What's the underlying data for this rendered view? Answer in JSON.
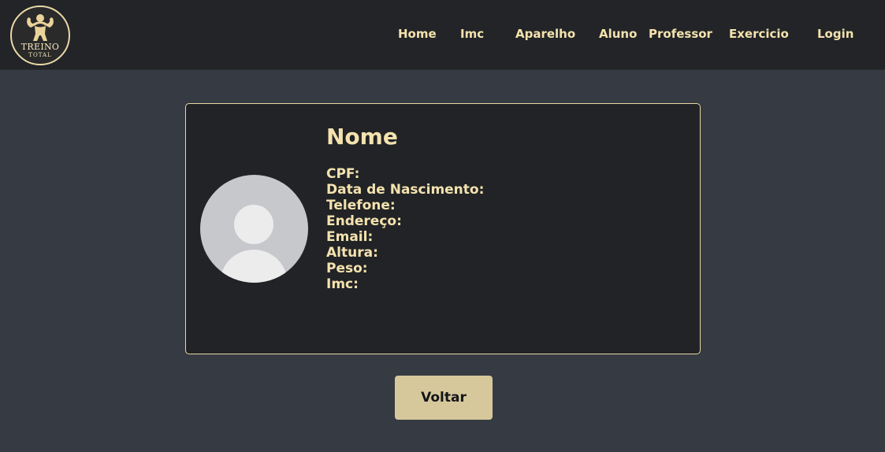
{
  "logo": {
    "line1": "TREINO",
    "line2": "TOTAL",
    "icon": "bodybuilder-icon"
  },
  "nav": {
    "items": [
      {
        "label": "Home"
      },
      {
        "label": "Imc"
      },
      {
        "label": "Aparelho"
      },
      {
        "label": "Aluno"
      },
      {
        "label": "Professor"
      },
      {
        "label": "Exercicio"
      },
      {
        "label": "Login"
      }
    ]
  },
  "profile": {
    "name": "Nome",
    "avatar_icon": "user-placeholder-icon",
    "fields": [
      {
        "label": "CPF:"
      },
      {
        "label": "Data de Nascimento:"
      },
      {
        "label": "Telefone:"
      },
      {
        "label": "Endereço:"
      },
      {
        "label": "Email:"
      },
      {
        "label": "Altura:"
      },
      {
        "label": "Peso:"
      },
      {
        "label": "Imc:"
      }
    ]
  },
  "actions": {
    "back_label": "Voltar"
  },
  "colors": {
    "background": "#363a42",
    "navbar": "#222427",
    "card": "#212326",
    "accent_text": "#f4e2ae",
    "card_border": "#e6d7a2",
    "button": "#d6c89b"
  }
}
